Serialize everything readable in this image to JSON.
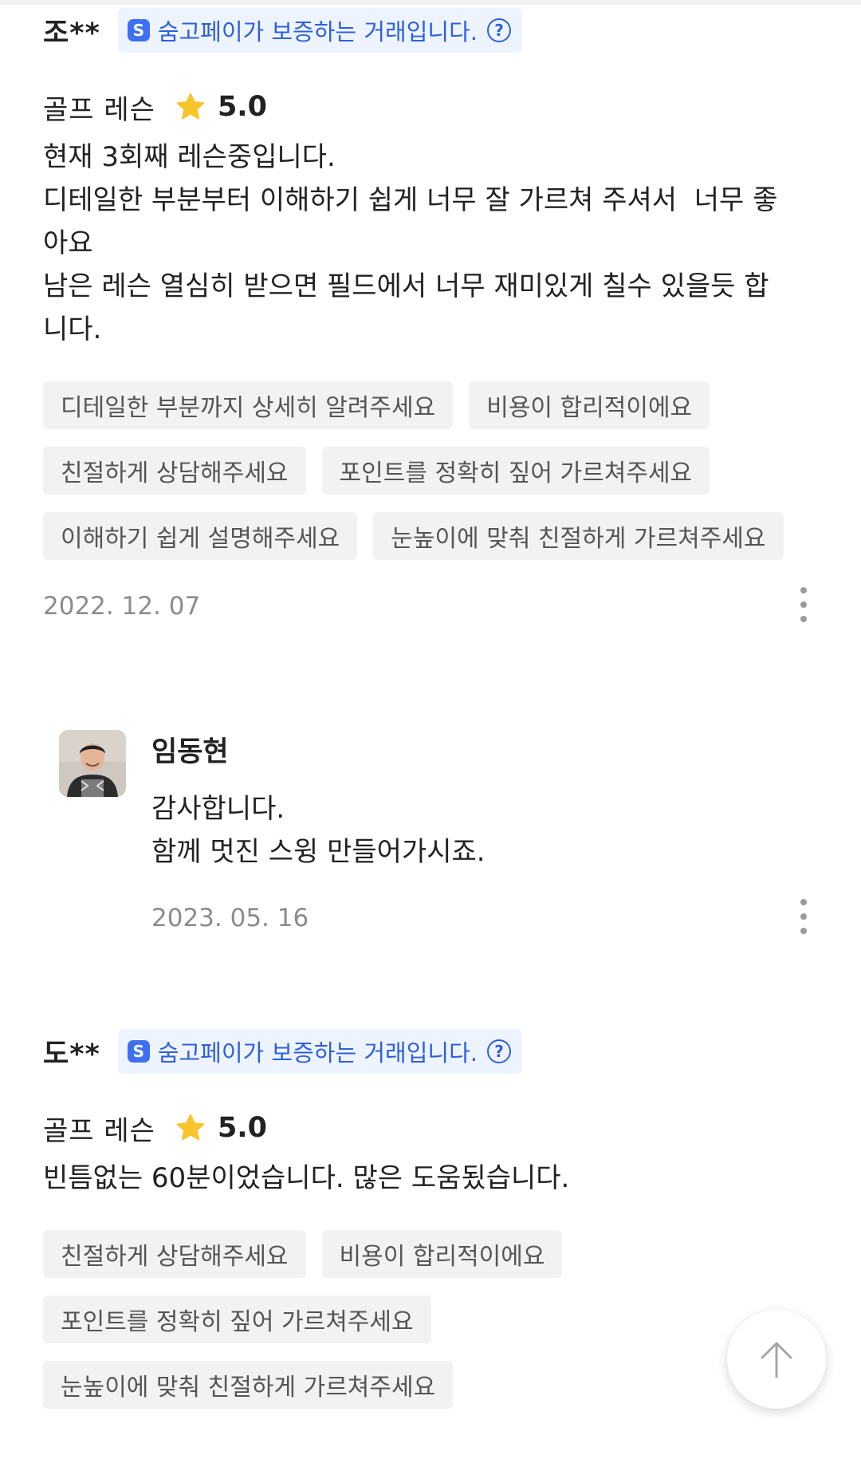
{
  "reviews": [
    {
      "reviewer": "조**",
      "badge_text": "숨고페이가 보증하는 거래입니다.",
      "service": "골프 레슨",
      "rating": "5.0",
      "body": "현재 3회째 레슨중입니다.\n디테일한 부분부터 이해하기 쉽게 너무 잘 가르쳐 주셔서  너무 좋아요\n남은 레슨 열심히 받으면 필드에서 너무 재미있게 칠수 있을듯 합니다.",
      "tags": [
        "디테일한 부분까지 상세히 알려주세요",
        "비용이 합리적이에요",
        "친절하게 상담해주세요",
        "포인트를 정확히 짚어 가르쳐주세요",
        "이해하기 쉽게 설명해주세요",
        "눈높이에 맞춰 친절하게 가르쳐주세요"
      ],
      "date": "2022. 12. 07"
    },
    {
      "reviewer": "도**",
      "badge_text": "숨고페이가 보증하는 거래입니다.",
      "service": "골프 레슨",
      "rating": "5.0",
      "body": "빈틈없는 60분이었습니다. 많은 도움됬습니다.",
      "tags": [
        "친절하게 상담해주세요",
        "비용이 합리적이에요",
        "포인트를 정확히 짚어 가르쳐주세요",
        "눈높이에 맞춰 친절하게 가르쳐주세요"
      ]
    }
  ],
  "reply": {
    "name": "임동현",
    "body": "감사합니다.\n함께 멋진 스윙 만들어가시죠.",
    "date": "2023. 05. 16"
  },
  "icons": {
    "badge_logo": "soomgo-pay-icon",
    "help": "question-circle-icon",
    "star": "star-icon",
    "more": "more-vertical-icon",
    "scroll_top": "arrow-up-icon"
  },
  "colors": {
    "star": "#f9c32b",
    "badge_bg": "#eef4ff",
    "badge_text": "#2e5fdc",
    "tag_bg": "#f2f2f2"
  }
}
